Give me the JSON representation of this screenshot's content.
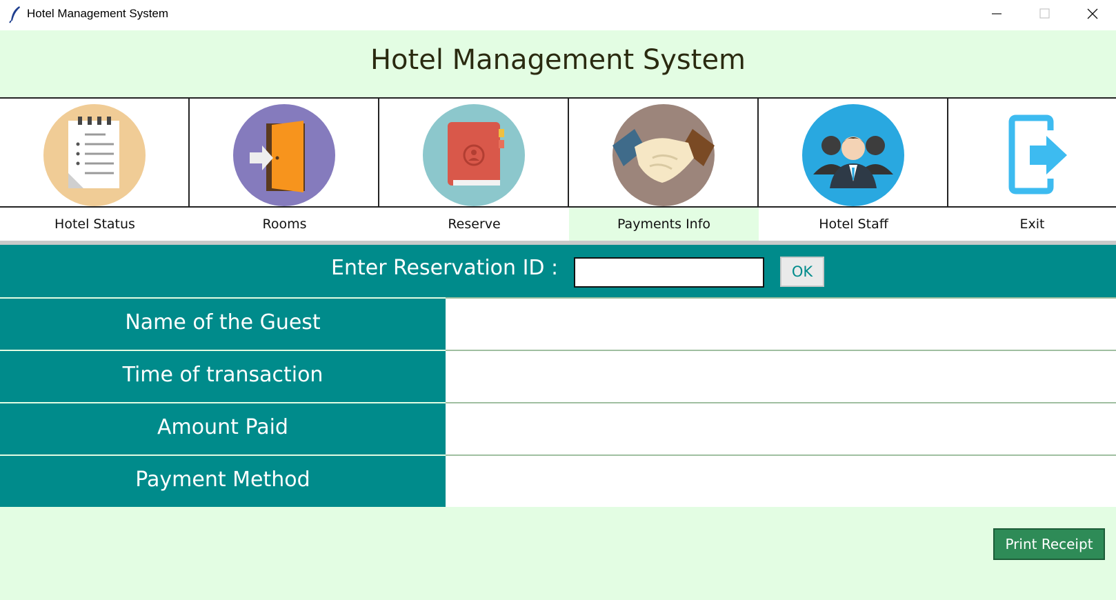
{
  "window": {
    "title": "Hotel Management System",
    "controls": [
      "minimize-icon",
      "maximize-icon",
      "close-icon"
    ]
  },
  "header": {
    "title": "Hotel Management System"
  },
  "nav": {
    "items": [
      {
        "label": "Hotel Status",
        "icon": "notepad-icon",
        "active": false
      },
      {
        "label": "Rooms",
        "icon": "door-icon",
        "active": false
      },
      {
        "label": "Reserve",
        "icon": "book-icon",
        "active": false
      },
      {
        "label": "Payments Info",
        "icon": "handshake-icon",
        "active": true
      },
      {
        "label": "Hotel Staff",
        "icon": "staff-icon",
        "active": false
      },
      {
        "label": "Exit",
        "icon": "exit-icon",
        "active": false
      }
    ]
  },
  "form": {
    "reservation_label": "Enter Reservation ID :",
    "reservation_value": "",
    "ok_label": "OK",
    "fields": [
      {
        "label": "Name of the Guest",
        "value": ""
      },
      {
        "label": "Time of transaction",
        "value": ""
      },
      {
        "label": "Amount Paid",
        "value": ""
      },
      {
        "label": "Payment Method",
        "value": ""
      }
    ],
    "print_label": "Print Receipt"
  },
  "colors": {
    "background": "#e3fde3",
    "teal": "#008b8b",
    "print_button": "#2e8b57"
  }
}
